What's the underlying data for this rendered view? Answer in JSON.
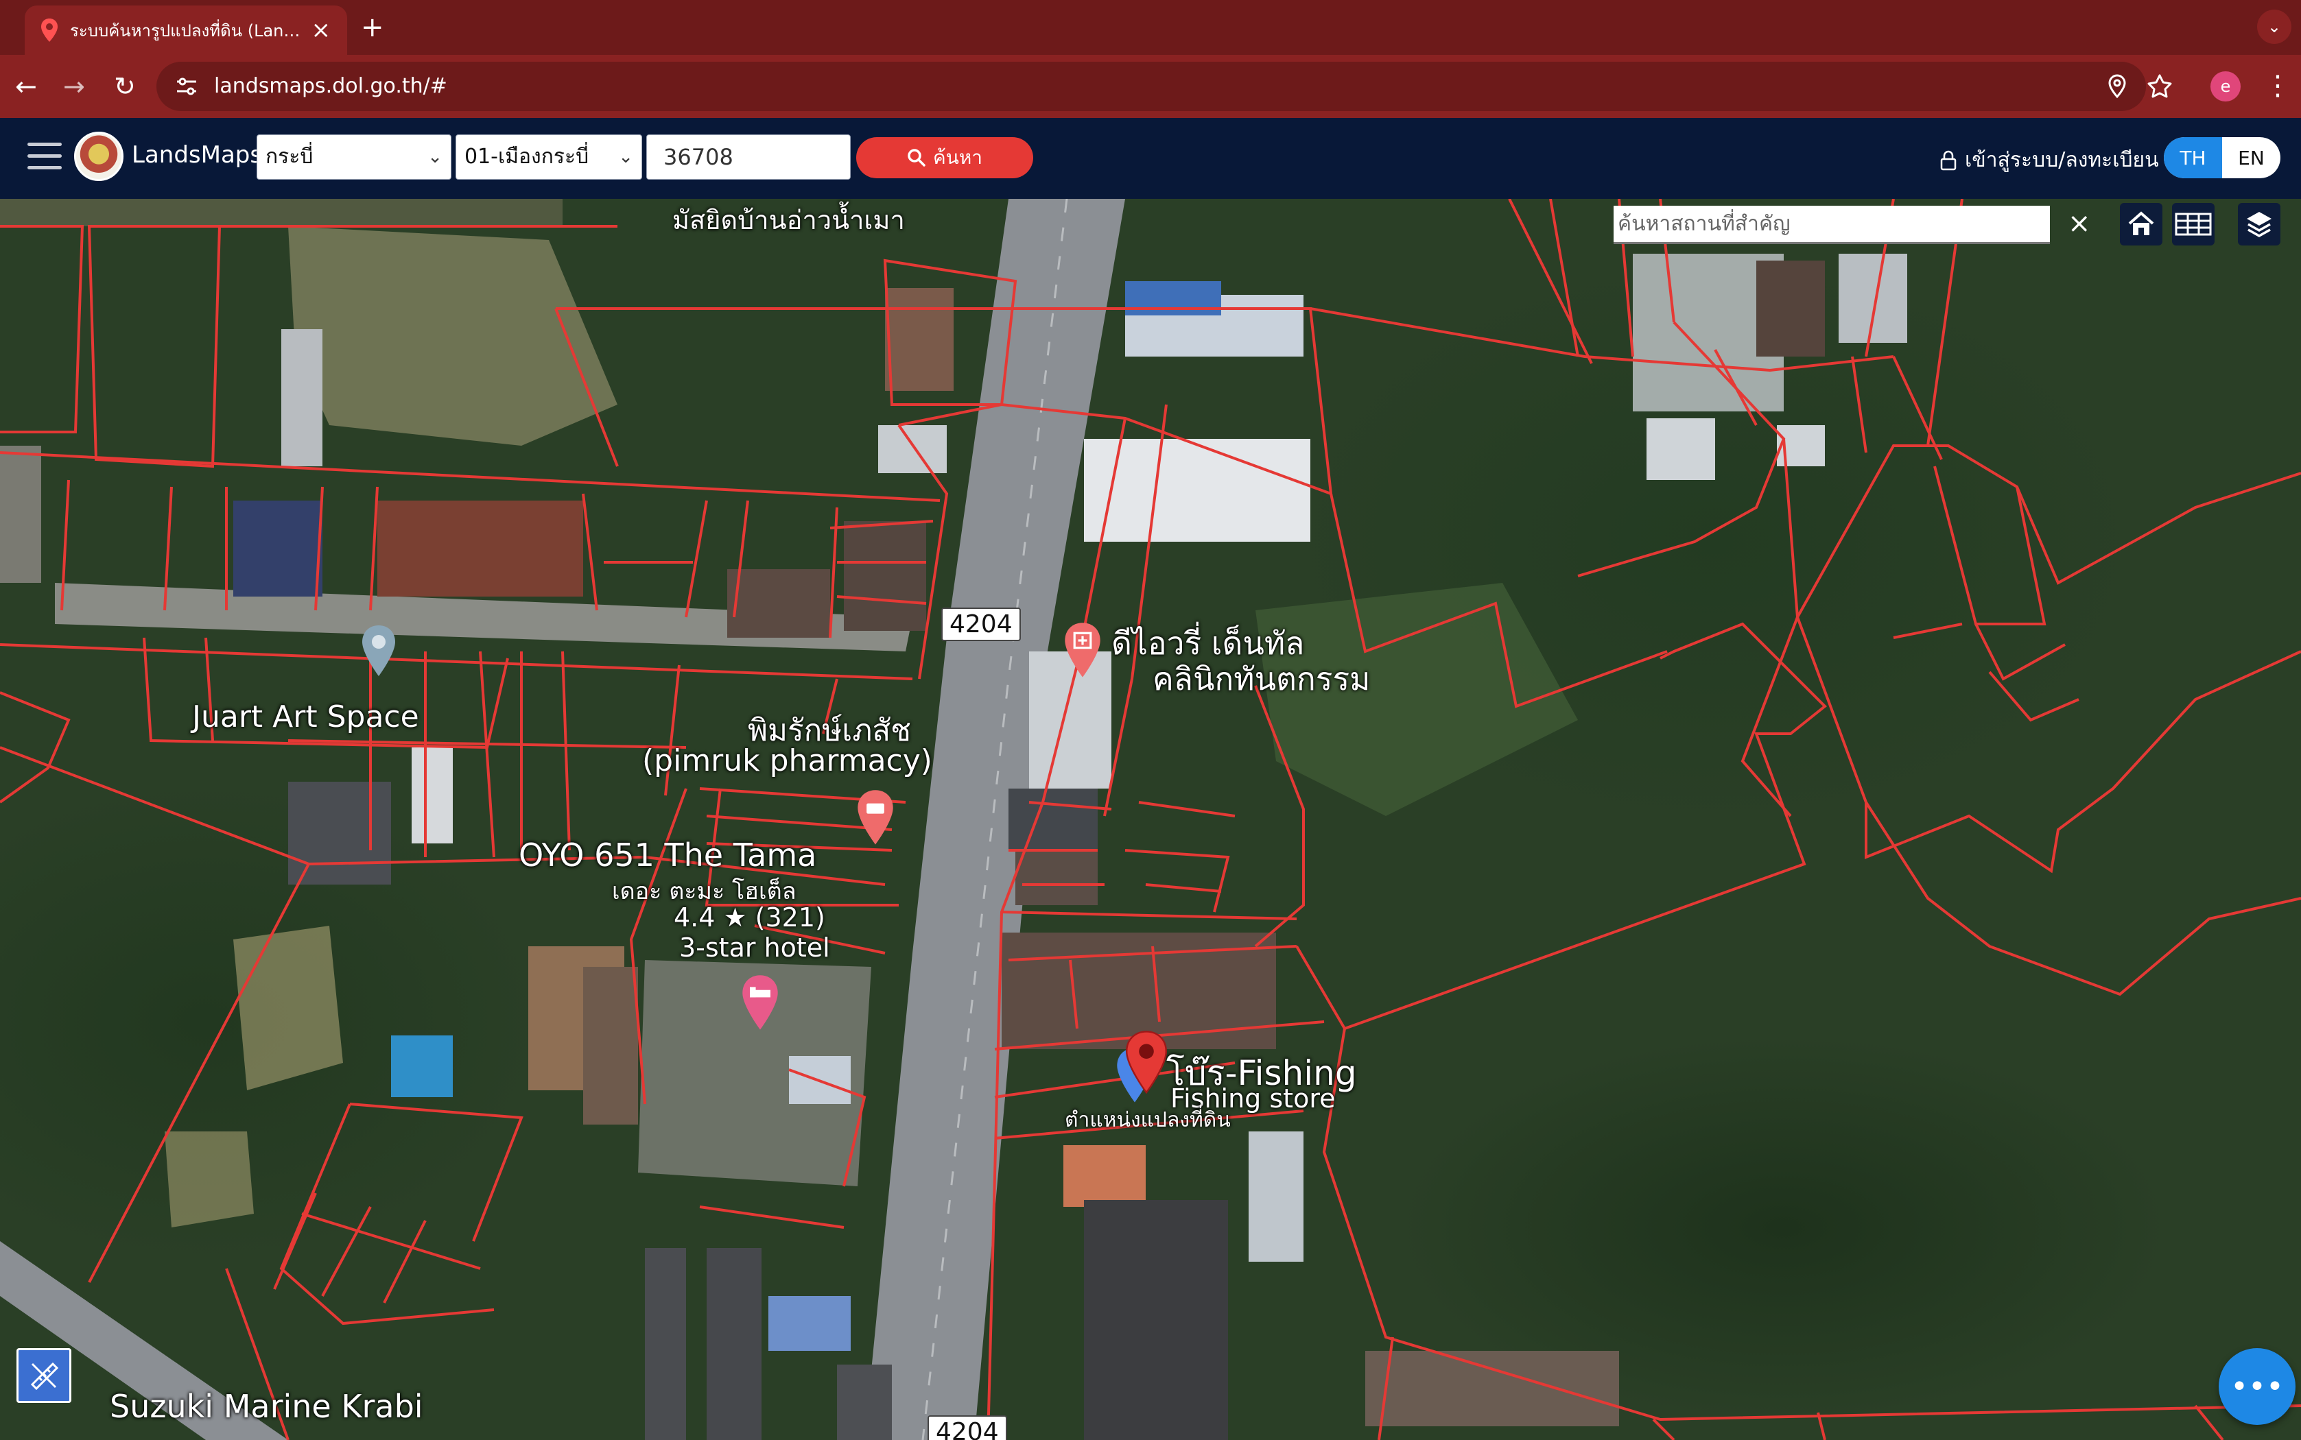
{
  "browser": {
    "tab_title": "ระบบค้นหารูปแปลงที่ดิน (LandsMaps)",
    "url": "landsmaps.dol.go.th/#",
    "profile_initial": "e",
    "theme_color": "#8a2222"
  },
  "header": {
    "brand": "LandsMaps",
    "province": "กระบี่",
    "district": "01-เมืองกระบี่",
    "parcel_number": "36708",
    "search_label": "ค้นหา",
    "login_label": "เข้าสู่ระบบ/ลงทะเบียน",
    "lang_th": "TH",
    "lang_en": "EN",
    "search_button_color": "#e53935",
    "active_lang_color": "#1e88e5"
  },
  "map": {
    "place_search_placeholder": "ค้นหาสถานที่สำคัญ",
    "parcel_line_color": "#e53935",
    "labels": {
      "mosque": "มัสยิดบ้านอ่าวน้ำเมา",
      "art_space": "Juart Art Space",
      "pharmacy_th": "พิมรักษ์เภสัช",
      "pharmacy_en": "(pimruk pharmacy)",
      "hotel": "OYO 651 The Tama",
      "hotel_th": "เดอะ ตะมะ โฮเต็ล",
      "hotel_rating": "4.4 ★ (321)",
      "hotel_type": "3-star hotel",
      "dental_line1": "ดีไอวรี่ เด็นทัล",
      "dental_line2": "คลินิกทันตกรรม",
      "fishing": "โบ๊ร-Fishing",
      "fishing_type": "Fishing store",
      "parcel_position": "ตำแหน่งแปลงที่ดิน",
      "suzuki": "Suzuki Marine Krabi",
      "road_sign_top": "4204",
      "road_sign_bottom": "4204"
    }
  }
}
